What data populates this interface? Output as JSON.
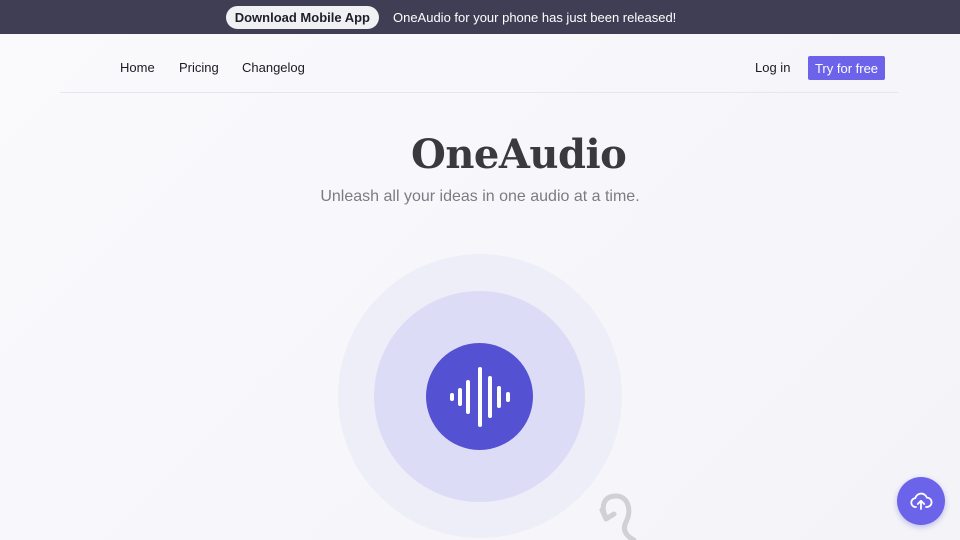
{
  "banner": {
    "button_label": "Download Mobile App",
    "message": "OneAudio for your phone has just been released!"
  },
  "nav": {
    "logo_icon": "waveform-icon",
    "links": [
      "Home",
      "Pricing",
      "Changelog"
    ],
    "login_label": "Log in",
    "cta_label": "Try for free"
  },
  "hero": {
    "logo_icon": "waveform-icon",
    "title": "OneAudio",
    "tagline": "Unleash all your ideas in one audio at a time."
  },
  "record": {
    "icon": "waveform-icon"
  },
  "fab": {
    "icon": "cloud-upload-icon"
  },
  "colors": {
    "banner_bg": "#3f3e54",
    "accent": "#6d63ea",
    "record_inner": "#5451d2",
    "record_mid": "#dcdcf6",
    "record_outer": "#eeeef8"
  }
}
